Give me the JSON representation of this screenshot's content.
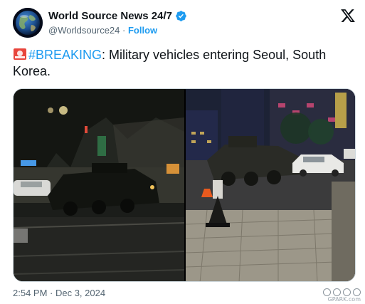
{
  "author": {
    "display_name": "World Source News 24/7",
    "handle": "@Worldsource24",
    "separator": "·",
    "follow_label": "Follow",
    "avatar_icon": "globe-avatar",
    "verified_icon": "verified-badge-icon",
    "verified_color": "#1d9bf0"
  },
  "header": {
    "platform_icon": "x-logo-icon"
  },
  "tweet": {
    "emoji_icon": "siren-icon",
    "hashtag": "#BREAKING",
    "text": ": Military vehicles entering Seoul, South Korea."
  },
  "media": {
    "photos": [
      {
        "name": "military-vehicle-photo-left"
      },
      {
        "name": "military-vehicle-photo-right"
      }
    ]
  },
  "footer": {
    "timestamp": "2:54 PM · Dec 3, 2024"
  },
  "watermark": {
    "text": "GPARK.com"
  },
  "colors": {
    "accent": "#1d9bf0",
    "text_primary": "#0f1419",
    "text_secondary": "#536471"
  }
}
